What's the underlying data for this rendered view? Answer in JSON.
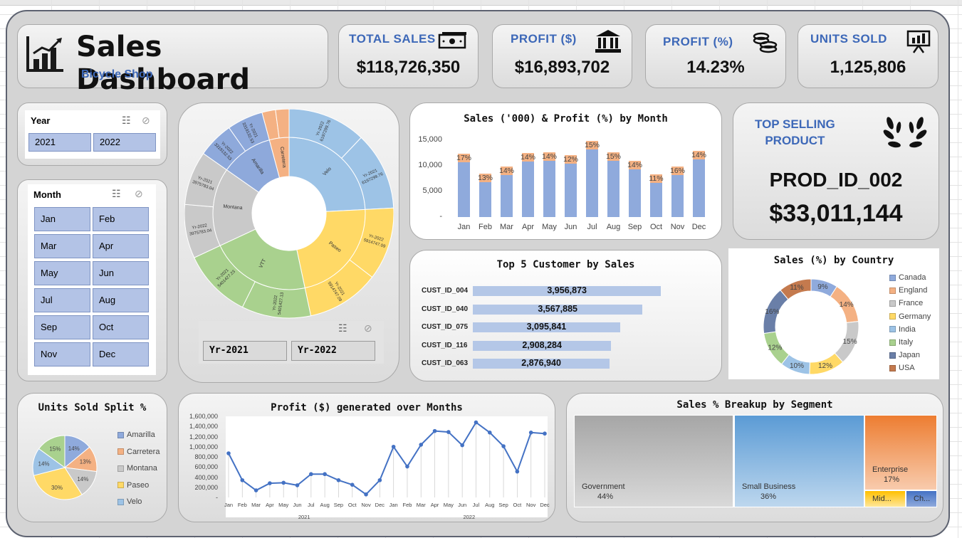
{
  "header": {
    "title": "Sales Dashboard",
    "subtitle": "Bicycle Shop"
  },
  "kpis": [
    {
      "title": "TOTAL SALES",
      "value": "$118,726,350",
      "icon": "money-icon"
    },
    {
      "title": "PROFIT ($)",
      "value": "$16,893,702",
      "icon": "bank-icon"
    },
    {
      "title": "PROFIT (%)",
      "value": "14.23%",
      "icon": "coins-icon"
    },
    {
      "title": "UNITS SOLD",
      "value": "1,125,806",
      "icon": "presentation-icon"
    }
  ],
  "year_slicer": {
    "title": "Year",
    "options": [
      "2021",
      "2022"
    ]
  },
  "month_slicer": {
    "title": "Month",
    "options": [
      "Jan",
      "Feb",
      "Mar",
      "Apr",
      "May",
      "Jun",
      "Jul",
      "Aug",
      "Sep",
      "Oct",
      "Nov",
      "Dec"
    ]
  },
  "sunburst": {
    "inner": [
      {
        "label": "Velo",
        "color": "#9dc3e6"
      },
      {
        "label": "Paseo",
        "color": "#ffd966"
      },
      {
        "label": "VTT",
        "color": "#a9d18e"
      },
      {
        "label": "Montana",
        "color": "#c9c9c9"
      },
      {
        "label": "Amarilla",
        "color": "#8ea9db"
      },
      {
        "label": "Carretera",
        "color": "#f4b183"
      }
    ],
    "outer_labels": [
      "Yr-2022\n6197299.76",
      "Yr-2021\n6197299.76",
      "Yr-2022\n5914747.09",
      "Yr-2021\n5914747.09",
      "Yr-2022\n5401427.13",
      "Yr-2021\n5401427.23",
      "Yr-2022\n3975783.04",
      "Yr-2021\n3975783.04",
      "Yr-2022\n3319132.53",
      "Yr-2021\n3319132.53"
    ],
    "slicer_options": [
      "Yr-2021",
      "Yr-2022"
    ]
  },
  "month_chart": {
    "title": "Sales ('000) & Profit (%) by Month",
    "yticks": [
      "15,000",
      "10,000",
      "5,000",
      "-"
    ],
    "months": [
      "Jan",
      "Feb",
      "Mar",
      "Apr",
      "May",
      "Jun",
      "Jul",
      "Aug",
      "Sep",
      "Oct",
      "Nov",
      "Dec"
    ],
    "pct_labels": [
      "17%",
      "13%",
      "14%",
      "14%",
      "14%",
      "12%",
      "15%",
      "15%",
      "14%",
      "11%",
      "16%",
      "14%"
    ]
  },
  "top_product": {
    "title_line1": "TOP SELLING",
    "title_line2": "PRODUCT",
    "id": "PROD_ID_002",
    "value": "$33,011,144"
  },
  "top_customers": {
    "title": "Top 5 Customer by Sales",
    "rows": [
      {
        "name": "CUST_ID_004",
        "value": "3,956,873"
      },
      {
        "name": "CUST_ID_040",
        "value": "3,567,885"
      },
      {
        "name": "CUST_ID_075",
        "value": "3,095,841"
      },
      {
        "name": "CUST_ID_116",
        "value": "2,908,284"
      },
      {
        "name": "CUST_ID_063",
        "value": "2,876,940"
      }
    ]
  },
  "country_chart": {
    "title": "Sales (%) by Country",
    "legend": [
      {
        "name": "Canada",
        "color": "#8faadc"
      },
      {
        "name": "England",
        "color": "#f4b183"
      },
      {
        "name": "France",
        "color": "#c9c9c9"
      },
      {
        "name": "Germany",
        "color": "#ffd966"
      },
      {
        "name": "India",
        "color": "#9dc3e6"
      },
      {
        "name": "Italy",
        "color": "#a9d18e"
      },
      {
        "name": "Japan",
        "color": "#6a7fa8"
      },
      {
        "name": "USA",
        "color": "#c47a4e"
      }
    ],
    "slice_labels": [
      "9%",
      "14%",
      "15%",
      "12%",
      "10%",
      "12%",
      "16%",
      "11%"
    ]
  },
  "units_chart": {
    "title": "Units Sold Split %",
    "legend": [
      {
        "name": "Amarilla",
        "color": "#8faadc"
      },
      {
        "name": "Carretera",
        "color": "#f4b183"
      },
      {
        "name": "Montana",
        "color": "#c9c9c9"
      },
      {
        "name": "Paseo",
        "color": "#ffd966"
      },
      {
        "name": "Velo",
        "color": "#9dc3e6"
      }
    ],
    "slice_labels": [
      "14%",
      "13%",
      "14%",
      "30%",
      "14%",
      "15%"
    ]
  },
  "profit_chart": {
    "title": "Profit ($) generated over Months",
    "yticks": [
      "1,600,000",
      "1,400,000",
      "1,200,000",
      "1,000,000",
      "800,000",
      "600,000",
      "400,000",
      "200,000",
      "-"
    ],
    "months": [
      "Jan",
      "Feb",
      "Mar",
      "Apr",
      "May",
      "Jun",
      "Jul",
      "Aug",
      "Sep",
      "Oct",
      "Nov",
      "Dec",
      "Jan",
      "Feb",
      "Mar",
      "Apr",
      "May",
      "Jun",
      "Jul",
      "Aug",
      "Sep",
      "Oct",
      "Nov",
      "Dec"
    ],
    "years": [
      "2021",
      "2022"
    ]
  },
  "segment_chart": {
    "title": "Sales % Breakup by Segment",
    "boxes": [
      {
        "name": "Government",
        "pct": "44%"
      },
      {
        "name": "Small Business",
        "pct": "36%"
      },
      {
        "name": "Enterprise",
        "pct": "17%"
      },
      {
        "name": "Mid...",
        "pct": ""
      },
      {
        "name": "Ch...",
        "pct": ""
      }
    ]
  },
  "chart_data": [
    {
      "type": "bar",
      "title": "Sales ('000) & Profit (%) by Month",
      "categories": [
        "Jan",
        "Feb",
        "Mar",
        "Apr",
        "May",
        "Jun",
        "Jul",
        "Aug",
        "Sep",
        "Oct",
        "Nov",
        "Dec"
      ],
      "series": [
        {
          "name": "Sales ('000)",
          "values": [
            10700,
            6800,
            8200,
            10900,
            11000,
            10400,
            13200,
            11000,
            9300,
            6600,
            8200,
            11200
          ]
        },
        {
          "name": "Profit (%)",
          "values": [
            17,
            13,
            14,
            14,
            14,
            12,
            15,
            15,
            14,
            11,
            16,
            14
          ]
        }
      ],
      "ylim": [
        0,
        15000
      ]
    },
    {
      "type": "bar",
      "title": "Top 5 Customer by Sales",
      "categories": [
        "CUST_ID_004",
        "CUST_ID_040",
        "CUST_ID_075",
        "CUST_ID_116",
        "CUST_ID_063"
      ],
      "values": [
        3956873,
        3567885,
        3095841,
        2908284,
        2876940
      ]
    },
    {
      "type": "pie",
      "title": "Sales (%) by Country",
      "categories": [
        "Canada",
        "England",
        "France",
        "Germany",
        "India",
        "Italy",
        "Japan",
        "USA"
      ],
      "values": [
        9,
        14,
        15,
        12,
        10,
        12,
        16,
        11
      ]
    },
    {
      "type": "pie",
      "title": "Units Sold Split %",
      "categories": [
        "Amarilla",
        "Carretera",
        "Montana",
        "Paseo",
        "Velo"
      ],
      "values": [
        14,
        13,
        14,
        30,
        14,
        15
      ]
    },
    {
      "type": "line",
      "title": "Profit ($) generated over Months",
      "x": [
        "Jan-2021",
        "Feb-2021",
        "Mar-2021",
        "Apr-2021",
        "May-2021",
        "Jun-2021",
        "Jul-2021",
        "Aug-2021",
        "Sep-2021",
        "Oct-2021",
        "Nov-2021",
        "Dec-2021",
        "Jan-2022",
        "Feb-2022",
        "Mar-2022",
        "Apr-2022",
        "May-2022",
        "Jun-2022",
        "Jul-2022",
        "Aug-2022",
        "Sep-2022",
        "Oct-2022",
        "Nov-2022",
        "Dec-2022"
      ],
      "values": [
        870000,
        340000,
        140000,
        280000,
        290000,
        240000,
        460000,
        460000,
        340000,
        250000,
        60000,
        340000,
        1000000,
        610000,
        1040000,
        1310000,
        1290000,
        1030000,
        1480000,
        1280000,
        1010000,
        510000,
        1280000,
        1260000
      ],
      "ylim": [
        0,
        1600000
      ]
    },
    {
      "type": "heatmap",
      "title": "Sales % Breakup by Segment",
      "categories": [
        "Government",
        "Small Business",
        "Enterprise",
        "Mid...",
        "Ch..."
      ],
      "values": [
        44,
        36,
        17,
        2,
        1
      ]
    }
  ]
}
